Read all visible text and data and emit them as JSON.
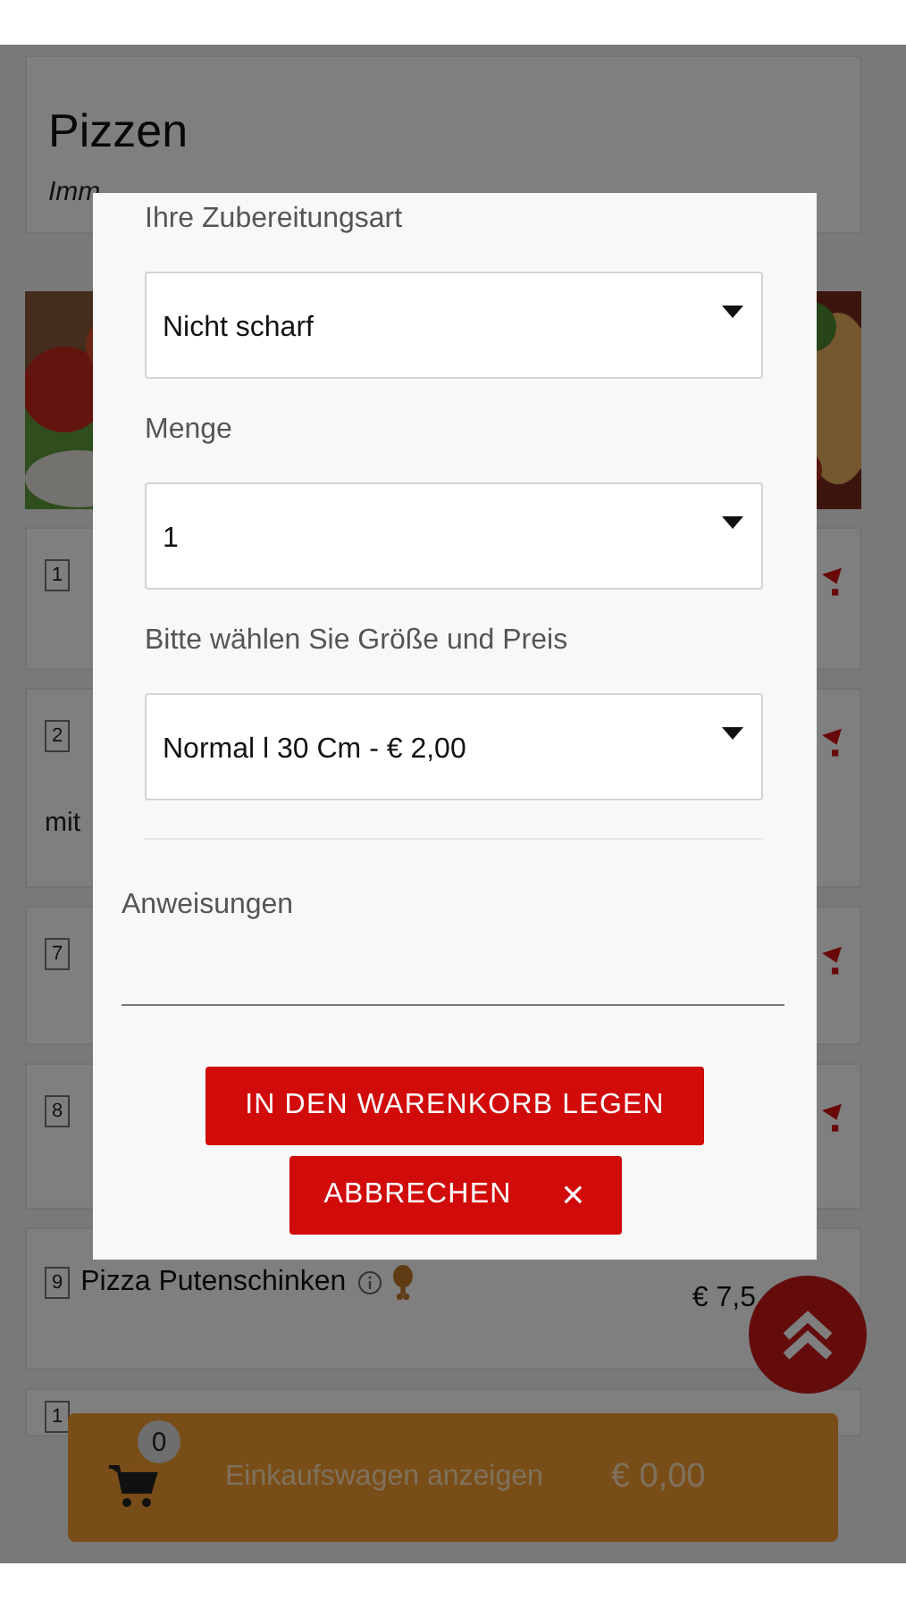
{
  "background": {
    "title": "Pizzen",
    "subtitle": "Imm",
    "items": [
      {
        "number": "1"
      },
      {
        "number": "2",
        "description": "mit"
      },
      {
        "number": "7"
      },
      {
        "number": "8"
      },
      {
        "number": "9",
        "name": "Pizza Putenschinken",
        "price": "€ 7,5"
      },
      {
        "number": "1"
      }
    ]
  },
  "dialog": {
    "fields": [
      {
        "label": "Ihre Zubereitungsart",
        "value": "Nicht scharf"
      },
      {
        "label": "Menge",
        "value": "1"
      },
      {
        "label": "Bitte wählen Sie Größe und Preis",
        "value": "Normal l 30 Cm - € 2,00"
      }
    ],
    "instructions": {
      "label": "Anweisungen"
    },
    "buttons": [
      {
        "label": "IN DEN WARENKORB LEGEN"
      },
      {
        "label": "ABBRECHEN",
        "icon": "×"
      }
    ]
  },
  "cart": {
    "count": "0",
    "label": "Einkaufswagen anzeigen",
    "total": "€ 0,00"
  }
}
